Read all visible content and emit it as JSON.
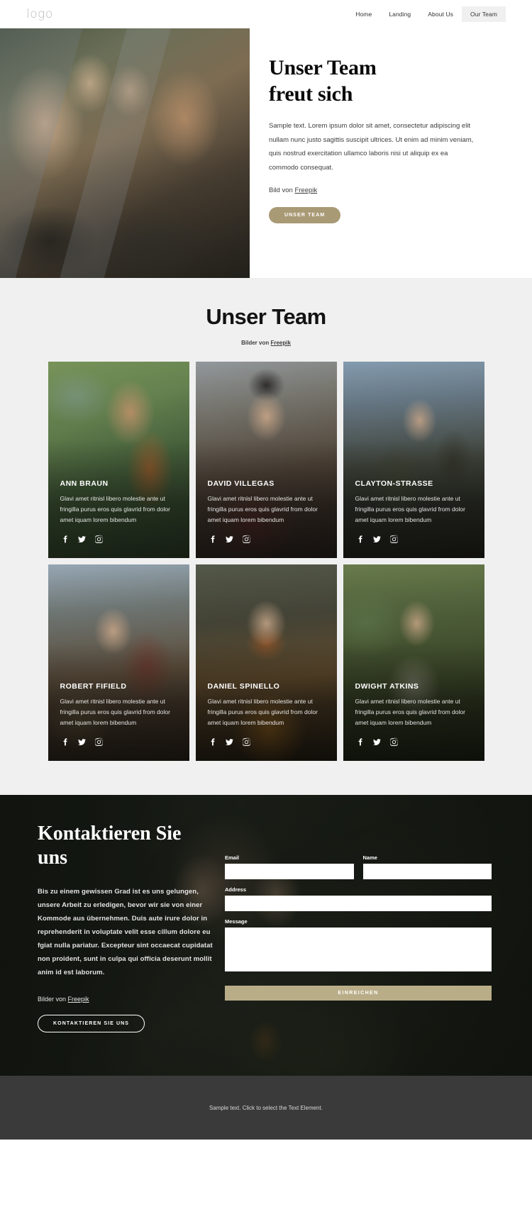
{
  "header": {
    "logo": "logo",
    "nav": [
      {
        "label": "Home",
        "active": false
      },
      {
        "label": "Landing",
        "active": false
      },
      {
        "label": "About Us",
        "active": false
      },
      {
        "label": "Our Team",
        "active": true
      }
    ]
  },
  "hero": {
    "title_line1": "Unser Team",
    "title_line2": "freut sich",
    "paragraph": "Sample text. Lorem ipsum dolor sit amet, consectetur adipiscing elit nullam nunc justo sagittis suscipit ultrices. Ut enim ad minim veniam, quis nostrud exercitation ullamco laboris nisi ut aliquip ex ea commodo consequat.",
    "credit_prefix": "Bild von ",
    "credit_link": "Freepik",
    "cta_label": "UNSER TEAM",
    "cta_color": "#a99a76"
  },
  "team": {
    "heading": "Unser Team",
    "credit_prefix": "Bilder von ",
    "credit_link": "Freepik",
    "social_icons": [
      "facebook-icon",
      "twitter-icon",
      "instagram-icon"
    ],
    "members": [
      {
        "name": "ANN BRAUN",
        "description": "Glavi amet ritnisl libero molestie ante ut fringilla purus eros quis glavrid from dolor amet iquam lorem bibendum"
      },
      {
        "name": "DAVID VILLEGAS",
        "description": "Glavi amet ritnisl libero molestie ante ut fringilla purus eros quis glavrid from dolor amet iquam lorem bibendum"
      },
      {
        "name": "CLAYTON-STRASSE",
        "description": "Glavi amet ritnisl libero molestie ante ut fringilla purus eros quis glavrid from dolor amet iquam lorem bibendum"
      },
      {
        "name": "ROBERT FIFIELD",
        "description": "Glavi amet ritnisl libero molestie ante ut fringilla purus eros quis glavrid from dolor amet iquam lorem bibendum"
      },
      {
        "name": "DANIEL SPINELLO",
        "description": "Glavi amet ritnisl libero molestie ante ut fringilla purus eros quis glavrid from dolor amet iquam lorem bibendum"
      },
      {
        "name": "DWIGHT ATKINS",
        "description": "Glavi amet ritnisl libero molestie ante ut fringilla purus eros quis glavrid from dolor amet iquam lorem bibendum"
      }
    ]
  },
  "contact": {
    "title_line1": "Kontaktieren Sie",
    "title_line2": "uns",
    "paragraph": "Bis zu einem gewissen Grad ist es uns gelungen, unsere Arbeit zu erledigen, bevor wir sie von einer Kommode aus übernehmen. Duis aute irure dolor in reprehenderit in voluptate velit esse cillum dolore eu fgiat nulla pariatur. Excepteur sint occaecat cupidatat non proident, sunt in culpa qui officia deserunt mollit anim id est laborum.",
    "credit_prefix": "Bilder von ",
    "credit_link": "Freepik",
    "outline_button": "KONTAKTIEREN SIE UNS",
    "form": {
      "email_label": "Email",
      "email_value": "",
      "email_placeholder": "",
      "name_label": "Name",
      "name_value": "",
      "name_placeholder": "",
      "address_label": "Address",
      "address_value": "",
      "address_placeholder": "",
      "message_label": "Message",
      "message_value": "",
      "message_placeholder": "",
      "submit_label": "EINREICHEN",
      "submit_color": "#b9ad88"
    }
  },
  "footer": {
    "text": "Sample text. Click to select the Text Element."
  }
}
